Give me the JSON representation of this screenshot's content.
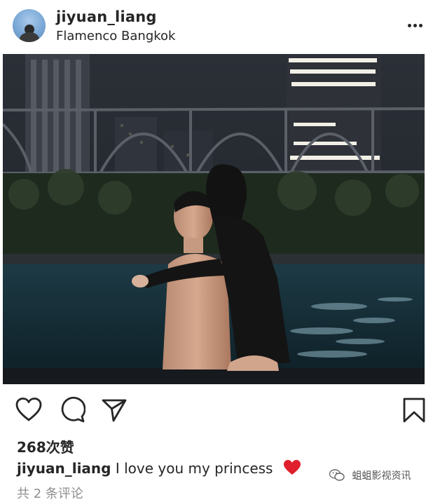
{
  "post": {
    "username": "jiyuan_liang",
    "location": "Flamenco Bangkok",
    "more_icon": "ellipsis-icon",
    "photo_alt": "couple in pool"
  },
  "actions": {
    "like_icon": "heart-icon",
    "comment_icon": "comment-icon",
    "share_icon": "send-icon",
    "save_icon": "bookmark-icon"
  },
  "likes_text": "268次赞",
  "caption": {
    "username": "jiyuan_liang",
    "text": "I love you my princess",
    "emoji": "red-heart-emoji"
  },
  "comments_text": "共 2 条评论",
  "watermark": {
    "text": "蛆蛆影视资讯",
    "icon": "wechat-icon"
  },
  "colors": {
    "text": "#262626",
    "muted": "#8e8e8e",
    "heart": "#e0202c"
  }
}
